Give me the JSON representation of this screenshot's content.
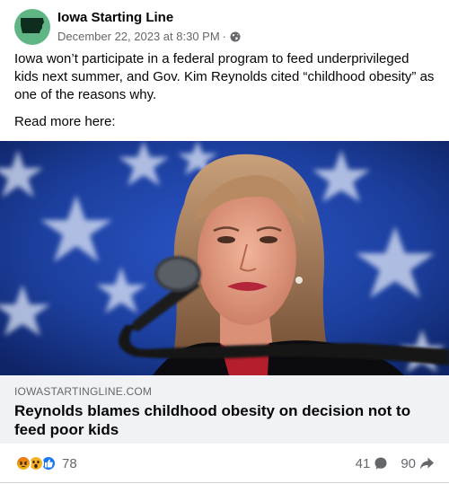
{
  "post": {
    "page_name": "Iowa Starting Line",
    "timestamp": "December 22, 2023 at 8:30 PM",
    "separator": "·",
    "privacy_icon": "globe-icon",
    "body_paragraph": "Iowa won’t participate in a federal program to feed underprivileged kids next summer, and Gov. Kim Reynolds cited “childhood obesity” as one of the reasons why.",
    "body_cta": "Read more here:"
  },
  "link_preview": {
    "domain": "IOWASTARTINGLINE.COM",
    "headline": "Reynolds blames childhood obesity on decision not to feed poor kids"
  },
  "engagement": {
    "reaction_icons": [
      "angry-icon",
      "wow-icon",
      "like-icon"
    ],
    "reaction_count": "78",
    "comment_count": "41",
    "share_count": "90"
  },
  "colors": {
    "avatar_bg": "#5fb583",
    "link_card_bg": "#f0f2f5",
    "meta_text": "#65676b",
    "like_blue": "#1877f2"
  }
}
